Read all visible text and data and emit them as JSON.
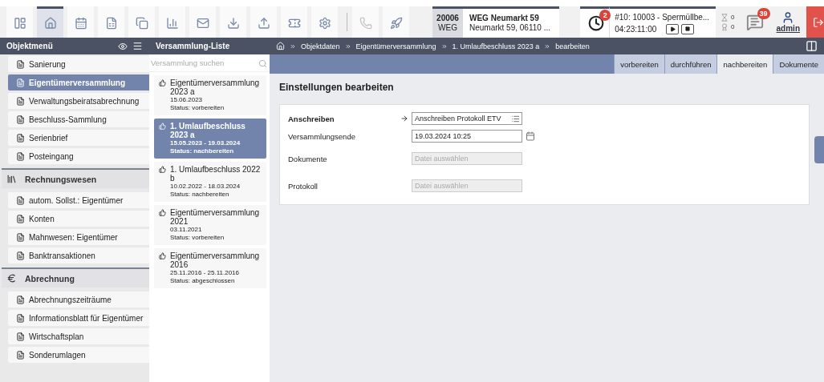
{
  "toolbar": {
    "buttons": [
      {
        "selected": false,
        "disabled": false
      },
      {
        "selected": true,
        "disabled": false
      },
      {
        "selected": false,
        "disabled": false
      },
      {
        "selected": false,
        "disabled": false
      },
      {
        "selected": false,
        "disabled": false
      },
      {
        "selected": false,
        "disabled": false
      },
      {
        "selected": false,
        "disabled": false
      },
      {
        "selected": false,
        "disabled": false
      },
      {
        "selected": false,
        "disabled": false
      },
      {
        "selected": false,
        "disabled": false
      },
      {
        "selected": false,
        "disabled": false
      },
      {
        "selected": false,
        "disabled": true
      },
      {
        "selected": false,
        "disabled": false
      }
    ],
    "object": {
      "number": "20006",
      "type": "WEG",
      "name": "WEG Neumarkt 59",
      "address": "Neumarkt 59, 06110 ..."
    },
    "reminders_badge": "2",
    "timer": {
      "task": "#10: 10003 - Spermüllbe...",
      "time": "04:23:11:00"
    },
    "counters": [
      "0",
      "0"
    ],
    "messages_badge": "39",
    "user": "admin"
  },
  "sidebar": {
    "title": "Objektmenü",
    "items": [
      {
        "kind": "item",
        "label": "Sanierung",
        "selected": false
      },
      {
        "kind": "item",
        "label": "Eigentümerversammlung",
        "selected": true
      },
      {
        "kind": "item",
        "label": "Verwaltungsbeiratsabrechnung",
        "selected": false
      },
      {
        "kind": "item",
        "label": "Beschluss-Sammlung",
        "selected": false
      },
      {
        "kind": "item",
        "label": "Serienbrief",
        "selected": false
      },
      {
        "kind": "item",
        "label": "Posteingang",
        "selected": false
      },
      {
        "kind": "section",
        "label": "Rechnungswesen"
      },
      {
        "kind": "item",
        "label": "autom. Sollst.: Eigentümer",
        "selected": false
      },
      {
        "kind": "item",
        "label": "Konten",
        "selected": false
      },
      {
        "kind": "item",
        "label": "Mahnwesen: Eigentümer",
        "selected": false
      },
      {
        "kind": "item",
        "label": "Banktransaktionen",
        "selected": false
      },
      {
        "kind": "section",
        "label": "Abrechnung"
      },
      {
        "kind": "item",
        "label": "Abrechnungszeiträume",
        "selected": false
      },
      {
        "kind": "item",
        "label": "Informationsblatt für Eigentümer",
        "selected": false
      },
      {
        "kind": "item",
        "label": "Wirtschaftsplan",
        "selected": false
      },
      {
        "kind": "item",
        "label": "Sonderumlagen",
        "selected": false
      }
    ]
  },
  "meetings": {
    "title": "Versammlung-Liste",
    "search": {
      "placeholder": "Versammlung suchen"
    },
    "items": [
      {
        "title": "Eigentümerversammlung 2023 a",
        "dates": "15.06.2023",
        "status": "Status: vorbereiten",
        "selected": false
      },
      {
        "title": "1. Umlaufbeschluss 2023 a",
        "dates": "15.05.2023 - 19.03.2024",
        "status": "Status: nachbereiten",
        "selected": true
      },
      {
        "title": "1. Umlaufbeschluss 2022 b",
        "dates": "10.02.2022 - 18.03.2024",
        "status": "Status: nachbereiten",
        "selected": false
      },
      {
        "title": "Eigentümerversammlung 2021",
        "dates": "03.11.2021",
        "status": "Status: vorbereiten",
        "selected": false
      },
      {
        "title": "Eigentümerversammlung 2016",
        "dates": "25.11.2016 - 25.11.2016",
        "status": "Status: abgeschlossen",
        "selected": false
      }
    ]
  },
  "breadcrumb": [
    "Objektdaten",
    "Eigentümerversammlung",
    "1. Umlaufbeschluss 2023 a",
    "bearbeiten"
  ],
  "tabs": [
    {
      "label": "vorbereiten",
      "selected": false
    },
    {
      "label": "durchführen",
      "selected": false
    },
    {
      "label": "nachbereiten",
      "selected": true
    },
    {
      "label": "Dokumente",
      "selected": false
    }
  ],
  "form": {
    "title": "Einstellungen bearbeiten",
    "fields": [
      {
        "kind": "select",
        "label": "Anschreiben",
        "value": "Anschreiben Protokoll ETV"
      },
      {
        "kind": "date",
        "label": "Versammlungsende",
        "value": "19.03.2024 10:25"
      },
      {
        "kind": "file",
        "label": "Dokumente",
        "placeholder": "Datei auswählen"
      },
      {
        "kind": "file",
        "label": "Protokoll",
        "placeholder": "Datei auswählen"
      }
    ]
  }
}
